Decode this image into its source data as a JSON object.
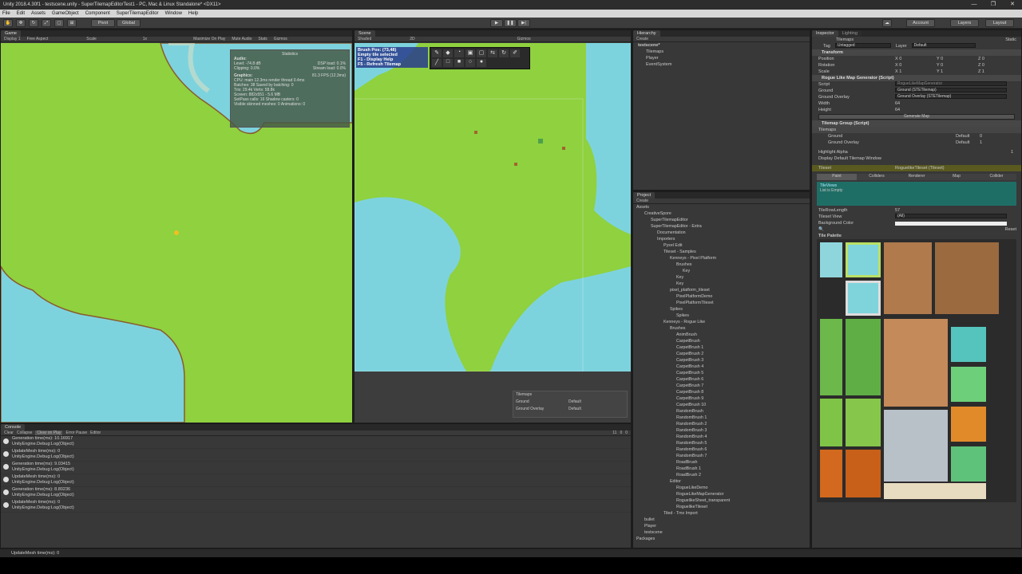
{
  "title": "Unity 2018.4.30f1 - testscene.unity - SuperTilemapEditorTest1 - PC, Mac & Linux Standalone* <DX11>",
  "window_buttons": [
    "—",
    "❐",
    "✕"
  ],
  "menu": [
    "File",
    "Edit",
    "Assets",
    "GameObject",
    "Component",
    "SuperTilemapEditor",
    "Window",
    "Help"
  ],
  "toolbar": {
    "pivot": "Pivot",
    "global": "Global",
    "account": "Account",
    "layers": "Layers",
    "layout": "Layout"
  },
  "game": {
    "tab": "Game",
    "display": "Display 1",
    "aspect": "Free Aspect",
    "scale_label": "Scale",
    "scale_value": "1x",
    "maximize": "Maximize On Play",
    "mute": "Mute Audio",
    "stats": "Stats",
    "gizmos": "Gizmos",
    "stats_panel": {
      "title": "Statistics",
      "audio_hdr": "Audio:",
      "audio": [
        "Level: -74.8 dB",
        "Clipping: 0.0%"
      ],
      "audio_r": [
        "DSP load: 0.1%",
        "Stream load: 0.0%"
      ],
      "graphics_hdr": "Graphics:",
      "fps": "81.3 FPS (12.3ms)",
      "lines": [
        "CPU: main 12.3ms  render thread 0.4ms",
        "Batches: 38   Saved by batching: 0",
        "Tris: 29.4k   Verts: 58.8k",
        "Screen: 882x551 - 5.6 MB",
        "SetPass calls: 16   Shadow casters: 0",
        "Visible skinned meshes: 0  Animations: 0"
      ]
    }
  },
  "scene": {
    "tab": "Scene",
    "shading": "Shaded",
    "mode": "2D",
    "gizmos": "Gizmos",
    "overlay": [
      "Brush Pos: (73,48)",
      "Empty tile selected",
      "F1 - Display Help",
      "F5 - Refresh Tilemap"
    ],
    "tilemaps_box": {
      "title": "Tilemaps",
      "rows": [
        {
          "name": "Ground",
          "layer": "Default"
        },
        {
          "name": "Ground Overlay",
          "layer": "Default"
        }
      ]
    }
  },
  "hierarchy": {
    "tab": "Hierarchy",
    "create": "Create",
    "items": [
      "testscene*",
      "Tilemaps",
      "Player",
      "EventSystem"
    ]
  },
  "project": {
    "tab": "Project",
    "create": "Create",
    "items": [
      "Assets",
      "CreativeSpore",
      "SuperTilemapEditor",
      "SuperTilemapEditor - Extra",
      "Documentation",
      "Importers",
      "Pyxel Edit",
      "Tileset - Samples",
      "Kenneys - Pixel Platform",
      "Brushes",
      "Key",
      "Key",
      "Key",
      "pixel_platform_tileset",
      "PixelPlatformDemo",
      "PixelPlatformTileset",
      "Spikes",
      "Spikes",
      "Kenneys - Rogue Like",
      "Brushes",
      "AnimBrush",
      "CarpetBrush",
      "CarpetBrush 1",
      "CarpetBrush 2",
      "CarpetBrush 3",
      "CarpetBrush 4",
      "CarpetBrush 5",
      "CarpetBrush 6",
      "CarpetBrush 7",
      "CarpetBrush 8",
      "CarpetBrush 9",
      "CarpetBrush 10",
      "RandomBrush",
      "RandomBrush 1",
      "RandomBrush 2",
      "RandomBrush 3",
      "RandomBrush 4",
      "RandomBrush 5",
      "RandomBrush 6",
      "RandomBrush 7",
      "RoadBrush",
      "RoadBrush 1",
      "RoadBrush 2",
      "Editor",
      "RogueLikeDemo",
      "RogueLikeMapGenerator",
      "RoguelikeSheet_transparent",
      "RoguelikeTileset",
      "Tiled - Tmx Import",
      "bullet",
      "Player",
      "testscene",
      "Packages"
    ]
  },
  "console": {
    "tab": "Console",
    "buttons": [
      "Clear",
      "Collapse",
      "Clear on Play",
      "Error Pause",
      "Editor"
    ],
    "counts": [
      "11",
      "0",
      "0"
    ],
    "lines": [
      [
        "Generation time(ms): 10.16917",
        "UnityEngine.Debug:Log(Object)"
      ],
      [
        "UpdateMesh time(ms): 0",
        "UnityEngine.Debug:Log(Object)"
      ],
      [
        "Generation time(ms): 9.03415",
        "UnityEngine.Debug:Log(Object)"
      ],
      [
        "UpdateMesh time(ms): 0",
        "UnityEngine.Debug:Log(Object)"
      ],
      [
        "Generation time(ms): 8.80236",
        "UnityEngine.Debug:Log(Object)"
      ],
      [
        "UpdateMesh time(ms): 0",
        "UnityEngine.Debug:Log(Object)"
      ]
    ],
    "status": "UpdateMesh time(ms): 0"
  },
  "inspector": {
    "tab": "Inspector",
    "tab2": "Lighting",
    "static": "Static",
    "object": "Tilemaps",
    "tag_label": "Tag",
    "tag": "Untagged",
    "layer_label": "Layer",
    "layer": "Default",
    "transform": "Transform",
    "position": "Position",
    "rotation": "Rotation",
    "scale": "Scale",
    "xyz": [
      "X 0",
      "Y 0",
      "Z 0"
    ],
    "scale_xyz": [
      "X 1",
      "Y 1",
      "Z 1"
    ],
    "rlmg": "Rogue Like Map Generator (Script)",
    "script_lbl": "Script",
    "script_val": "RogueLikeMapGenerator",
    "ground_lbl": "Ground",
    "ground_val": "Ground (STETilemap)",
    "overlay_lbl": "Ground Overlay",
    "overlay_val": "Ground Overlay (STETilemap)",
    "width_lbl": "Width",
    "width": "64",
    "height_lbl": "Height",
    "height": "64",
    "generate": "Generate Map",
    "tg": "Tilemap Group (Script)",
    "tilemaps_lbl": "Tilemaps",
    "tg_rows": [
      {
        "name": "Ground",
        "layer": "Default",
        "order": "0"
      },
      {
        "name": "Ground Overlay",
        "layer": "Default",
        "order": "1"
      }
    ],
    "highlight": "Highlight Alpha",
    "highlight_val": "1",
    "display_default": "Display Default Tilemap Window",
    "tileset_lbl": "Tileset",
    "tileset_val": "RoguelikeTileset (Tileset)",
    "tabs": [
      "Paint",
      "Colliders",
      "Renderer",
      "Map",
      "Collider"
    ],
    "tileviews": "TileViews",
    "tileviews_sub": "List is Empty",
    "tile_row_length": "TileRowLength",
    "tile_row_val": "57",
    "tileset_view": "Tileset View",
    "tileset_view_val": "(All)",
    "bg_color": "Background Color",
    "reset": "Reset",
    "palette": "Tile Palette"
  }
}
